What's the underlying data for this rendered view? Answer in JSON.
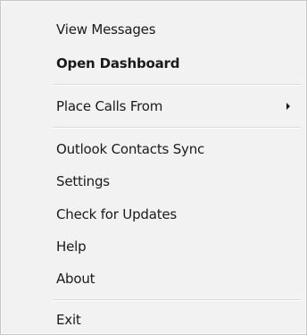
{
  "menu": {
    "items": [
      {
        "label": "View Messages"
      },
      {
        "label": "Open Dashboard",
        "bold": true
      },
      {
        "label": "Place Calls From",
        "submenu_icon": "chevron-right-icon"
      },
      {
        "label": "Outlook Contacts Sync"
      },
      {
        "label": "Settings"
      },
      {
        "label": "Check for Updates"
      },
      {
        "label": "Help"
      },
      {
        "label": "About"
      },
      {
        "label": "Exit"
      }
    ]
  }
}
